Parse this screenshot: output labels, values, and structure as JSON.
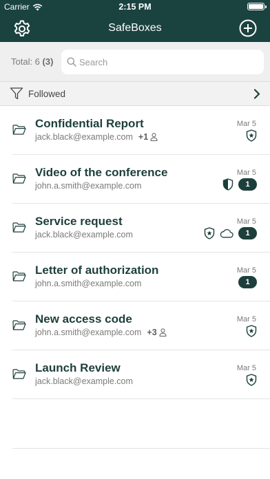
{
  "status": {
    "carrier": "Carrier",
    "time": "2:15 PM"
  },
  "nav": {
    "title": "SafeBoxes"
  },
  "summary": {
    "total_label": "Total: 6",
    "total_followed": "(3)"
  },
  "search": {
    "placeholder": "Search"
  },
  "filter": {
    "label": "Followed"
  },
  "colors": {
    "primary": "#1a4340",
    "accent": "#1d3f3b",
    "background_bar": "#efefef"
  },
  "safeboxes": [
    {
      "title": "Confidential Report",
      "email": "jack.black@example.com",
      "extra": "+1",
      "date": "Mar 5",
      "icons": [
        "star-shield-icon"
      ],
      "badge": ""
    },
    {
      "title": "Video of the conference",
      "email": "john.a.smith@example.com",
      "extra": "",
      "date": "Mar 5",
      "icons": [
        "half-shield-icon"
      ],
      "badge": "1"
    },
    {
      "title": "Service request",
      "email": "jack.black@example.com",
      "extra": "",
      "date": "Mar 5",
      "icons": [
        "star-shield-icon",
        "cloud-icon"
      ],
      "badge": "1"
    },
    {
      "title": "Letter of authorization",
      "email": "john.a.smith@example.com",
      "extra": "",
      "date": "Mar 5",
      "icons": [],
      "badge": "1"
    },
    {
      "title": "New access code",
      "email": "john.a.smith@example.com",
      "extra": "+3",
      "date": "Mar 5",
      "icons": [
        "star-shield-icon"
      ],
      "badge": ""
    },
    {
      "title": "Launch Review",
      "email": "jack.black@example.com",
      "extra": "",
      "date": "Mar 5",
      "icons": [
        "star-shield-icon"
      ],
      "badge": ""
    }
  ]
}
